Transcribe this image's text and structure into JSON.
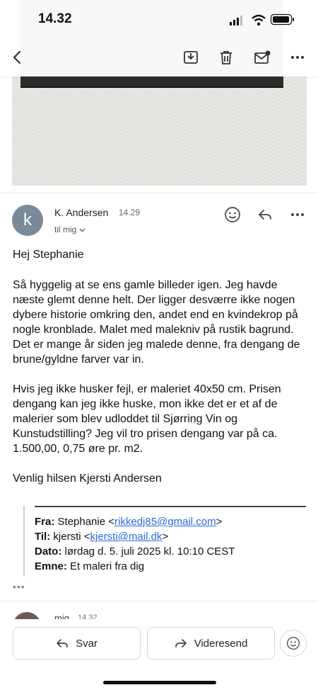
{
  "status": {
    "time": "14.32"
  },
  "nav": {
    "back_icon": "chevron-left-icon",
    "archive_icon": "archive-icon",
    "delete_icon": "trash-icon",
    "unread_icon": "mark-unread-icon",
    "more_icon": "more-horizontal-icon"
  },
  "message": {
    "avatar_initial": "k",
    "sender": "K. Andersen",
    "time": "14.29",
    "recipient_summary": "til mig",
    "greeting": "Hej Stephanie",
    "paragraph1": "Så hyggelig at se ens gamle billeder igen. Jeg havde næste glemt denne helt. Der ligger desværre ikke nogen dybere historie omkring den, andet end en kvindekrop på nogle kronblade. Malet med malekniv på rustik bagrund. Det er mange år siden jeg malede denne, fra dengang de brune/gyldne farver var in.",
    "paragraph2": "Hvis jeg ikke husker fejl, er maleriet 40x50 cm. Prisen dengang kan jeg ikke huske, mon ikke det er et af de malerier som blev udloddet til Sjørring Vin og Kunstudstilling?  Jeg vil tro prisen dengang var på ca. 1.500,00, 0,75 øre pr. m2.",
    "signoff": "Venlig hilsen Kjersti Andersen"
  },
  "quoted": {
    "from_label": "Fra:",
    "from_name": "Stephanie <",
    "from_email": "rikkedj85@gmail.com",
    "from_close": ">",
    "to_label": "Til:",
    "to_name": "kjersti <",
    "to_email": "kjersti@mail.dk",
    "to_close": ">",
    "date_label": "Dato:",
    "date_value": "lørdag d. 5. juli 2025 kl. 10:10 CEST",
    "subject_label": "Emne:",
    "subject_value": "Et maleri fra dig"
  },
  "trimmed_indicator": "•••",
  "next_message": {
    "sender": "mig",
    "time": "14.32"
  },
  "actions": {
    "reply_label": "Svar",
    "forward_label": "Videresend"
  },
  "colors": {
    "link": "#2a6bd8",
    "avatar_bg": "#7a8a99"
  }
}
